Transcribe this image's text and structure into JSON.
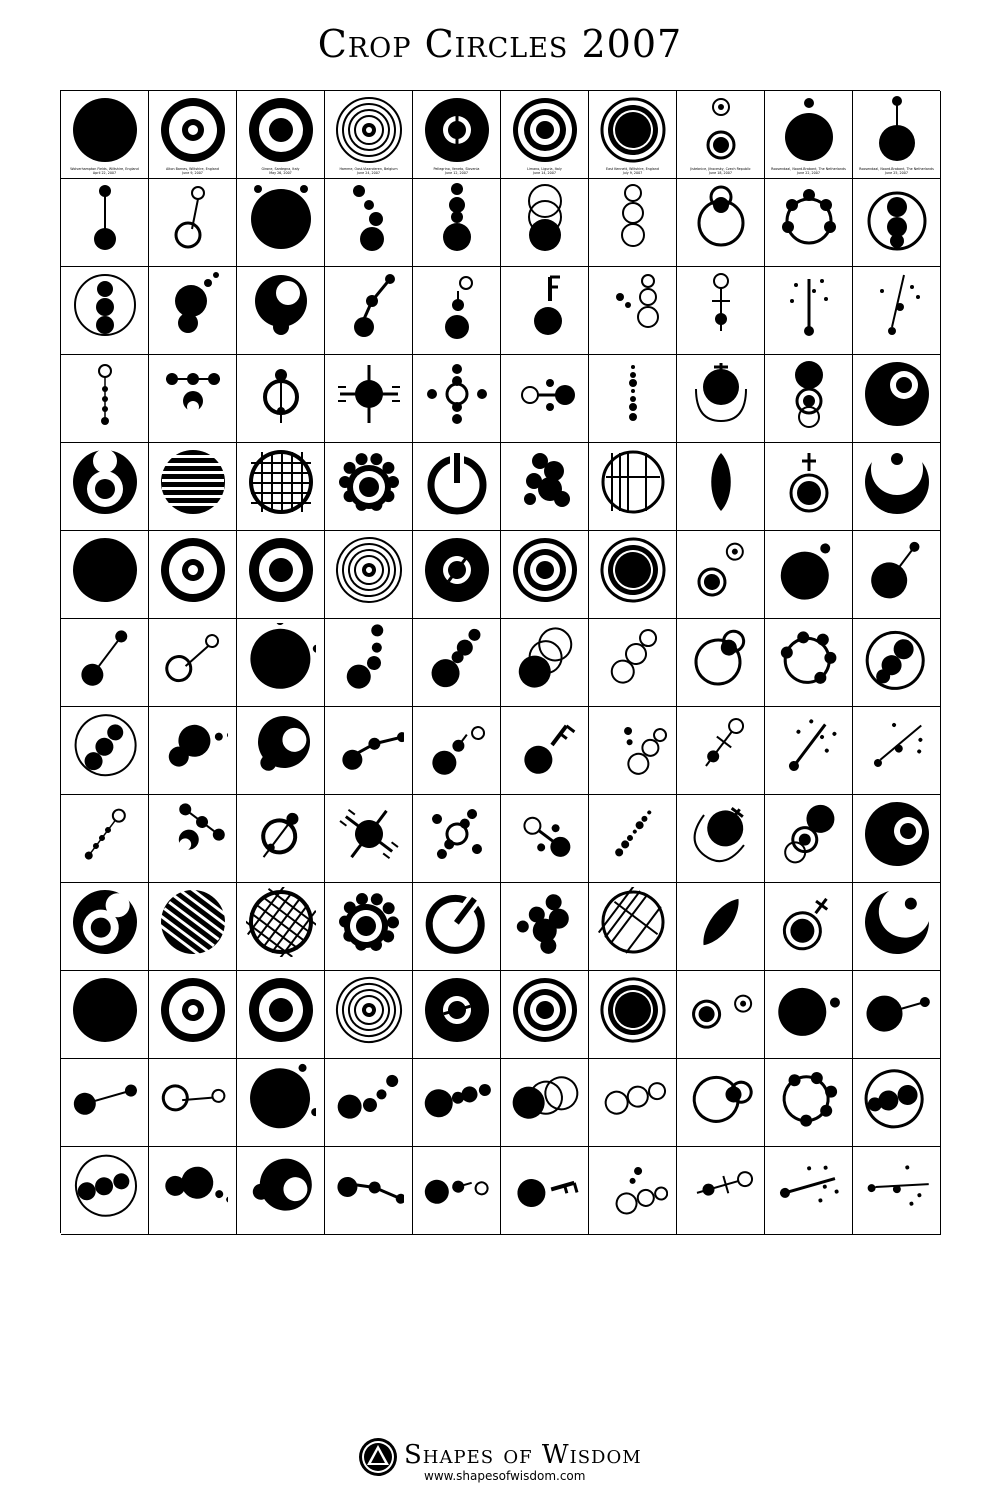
{
  "title": "Crop Circles 2007",
  "brand": {
    "name": "Shapes of Wisdom",
    "url": "www.shapesofwisdom.com",
    "logo_icon": "triangle-in-circle-logo-icon"
  },
  "grid": {
    "columns": 10,
    "rows": 13,
    "captions_row_1": [
      {
        "place": "Wolverhampton Fields, Wiltshire, England",
        "date": "April 22, 2007"
      },
      {
        "place": "Alton Barnes, Wiltshire, England",
        "date": "June 9, 2007"
      },
      {
        "place": "Girone, Sardegna, Italy",
        "date": "May 26, 2007"
      },
      {
        "place": "Hamme, Oost-Vlaanderen, Belgium",
        "date": "June 24, 2007"
      },
      {
        "place": "Pellegrino, Veneto, Slovenia",
        "date": "June 12, 2007"
      },
      {
        "place": "Limano, Liguria, Italy",
        "date": "June 14, 2007"
      },
      {
        "place": "East Kennett, Wiltshire, England",
        "date": "July 9, 2007"
      },
      {
        "place": "Jistebnice, Jihocesky, Czech Republic",
        "date": "June 18, 2007"
      },
      {
        "place": "Roosendaal, Noord-Brabant, The Netherlands",
        "date": "June 22, 2007"
      },
      {
        "place": "Roosendaal, Noord-Brabant, The Netherlands",
        "date": "June 25, 2007"
      }
    ]
  }
}
